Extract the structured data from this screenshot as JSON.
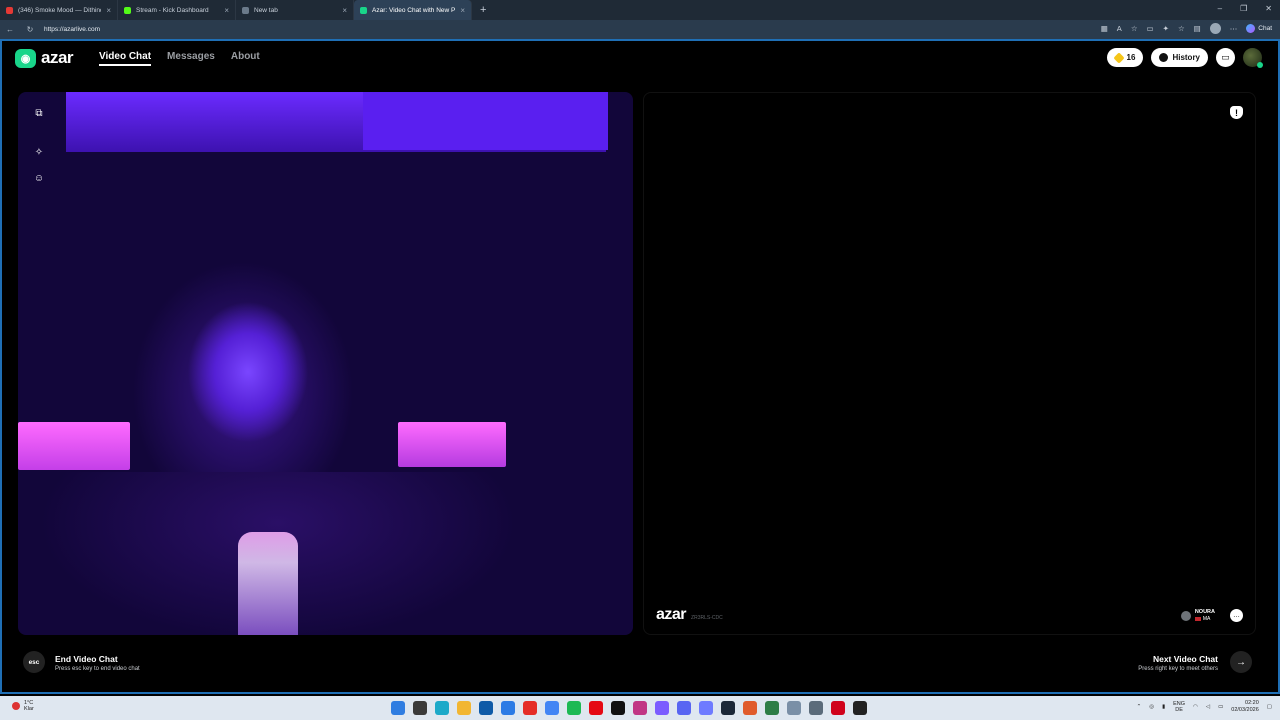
{
  "browser": {
    "tabs": [
      {
        "title": "(346) Smoke Mood — Dithindo &...",
        "color": "#e53935",
        "active": false
      },
      {
        "title": "Stream - Kick Dashboard",
        "color": "#53fc18",
        "active": false
      },
      {
        "title": "New tab",
        "color": "#6b7a8a",
        "active": false
      },
      {
        "title": "Azar: Video Chat with New Pe...",
        "color": "#19d58a",
        "active": true
      }
    ],
    "url": "https://azarlive.com",
    "chat_label": "Chat"
  },
  "app": {
    "logo": "azar",
    "nav": {
      "video_chat": "Video Chat",
      "messages": "Messages",
      "about": "About"
    },
    "gems": "16",
    "history": "History"
  },
  "remote": {
    "watermark": "azar",
    "watermark_id": "ZR3RLS-CDC",
    "peer_name": "NOURA",
    "peer_country": "MA"
  },
  "controls": {
    "end_key": "esc",
    "end_title": "End Video Chat",
    "end_sub": "Press esc key to end video chat",
    "next_title": "Next Video Chat",
    "next_sub": "Press right key to meet others",
    "next_icon": "→"
  },
  "taskbar": {
    "weather_temp": "1°C",
    "weather_text": "Klar",
    "lang_top": "ENG",
    "lang_bottom": "DE",
    "time": "02:20",
    "date": "02/03/2026"
  }
}
